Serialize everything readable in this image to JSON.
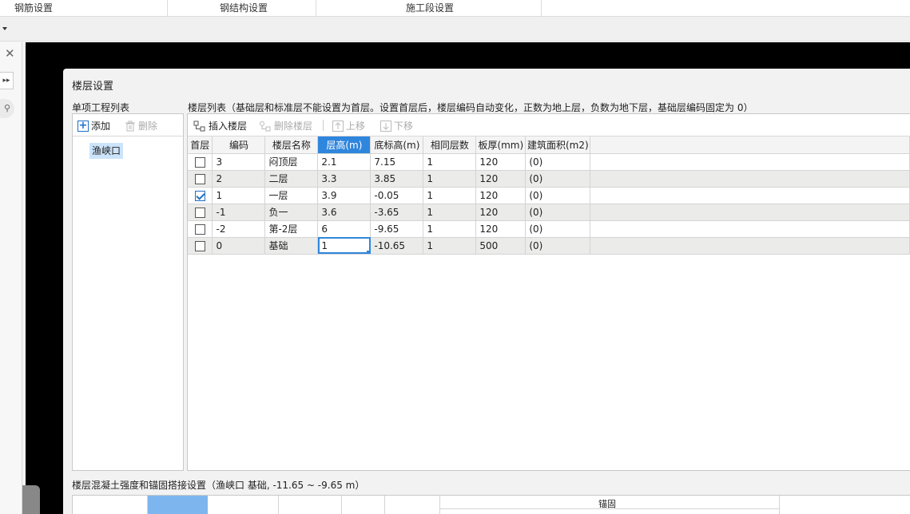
{
  "top_tabs": [
    "钢筋设置",
    "钢结构设置",
    "施工段设置"
  ],
  "dialog": {
    "title": "楼层设置",
    "project_list_label": "单项工程列表",
    "add_label": "添加",
    "delete_label": "删除",
    "projects": [
      "渔峡口"
    ],
    "floor_list_label": "楼层列表（基础层和标准层不能设置为首层。设置首层后，楼层编码自动变化，正数为地上层，负数为地下层，基础层编码固定为 0）",
    "toolbar": {
      "insert_floor": "插入楼层",
      "delete_floor": "删除楼层",
      "move_up": "上移",
      "move_down": "下移"
    },
    "columns": [
      "首层",
      "编码",
      "楼层名称",
      "层高(m)",
      "底标高(m)",
      "相同层数",
      "板厚(mm)",
      "建筑面积(m2)"
    ],
    "rows": [
      {
        "first": false,
        "code": "3",
        "name": "闷顶层",
        "height": "2.1",
        "bottom": "7.15",
        "same": "1",
        "thickness": "120",
        "area": "(0)"
      },
      {
        "first": false,
        "code": "2",
        "name": "二层",
        "height": "3.3",
        "bottom": "3.85",
        "same": "1",
        "thickness": "120",
        "area": "(0)"
      },
      {
        "first": true,
        "code": "1",
        "name": "一层",
        "height": "3.9",
        "bottom": "-0.05",
        "same": "1",
        "thickness": "120",
        "area": "(0)"
      },
      {
        "first": false,
        "code": "-1",
        "name": "负一",
        "height": "3.6",
        "bottom": "-3.65",
        "same": "1",
        "thickness": "120",
        "area": "(0)"
      },
      {
        "first": false,
        "code": "-2",
        "name": "第-2层",
        "height": "6",
        "bottom": "-9.65",
        "same": "1",
        "thickness": "120",
        "area": "(0)"
      },
      {
        "first": false,
        "code": "0",
        "name": "基础",
        "height": "1",
        "bottom": "-10.65",
        "same": "1",
        "thickness": "500",
        "area": "(0)"
      }
    ],
    "concrete_label": "楼层混凝土强度和锚固搭接设置（渔峡口  基础, -11.65 ~ -9.65 m）",
    "anchor_label": "锚固"
  },
  "colors": {
    "accent": "#2f86dd",
    "selection": "#cce4fb",
    "row_alt": "#ebebe9"
  }
}
